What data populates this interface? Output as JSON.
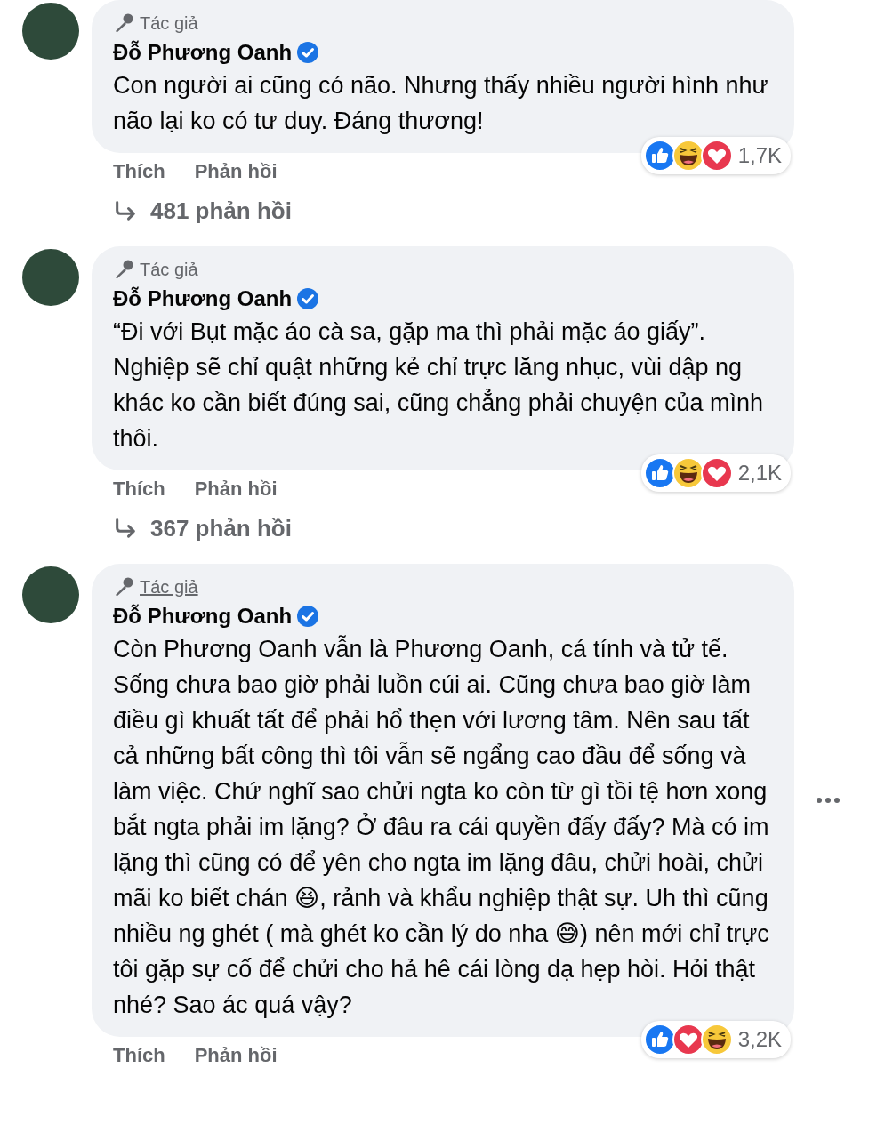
{
  "comments": [
    {
      "badge": "Tác giả",
      "badge_underlined": false,
      "author": "Đỗ Phương Oanh",
      "verified": true,
      "text": "Con người ai cũng có não. Nhưng thấy nhiều người hình như não lại ko có tư duy. Đáng thương!",
      "reactions": [
        {
          "kind": "like"
        },
        {
          "kind": "haha"
        },
        {
          "kind": "love"
        }
      ],
      "reaction_count": "1,7K",
      "actions": [
        "Thích",
        "Phản hồi"
      ],
      "replies": "481 phản hồi",
      "more_menu": false
    },
    {
      "badge": "Tác giả",
      "badge_underlined": false,
      "author": "Đỗ Phương Oanh",
      "verified": true,
      "text": "“Đi với Bụt mặc áo cà sa, gặp ma thì phải mặc áo giấy”. Nghiệp sẽ chỉ quật những kẻ chỉ trực lăng nhục, vùi dập ng khác ko cần biết đúng sai, cũng chẳng phải chuyện của mình thôi.",
      "reactions": [
        {
          "kind": "like"
        },
        {
          "kind": "haha"
        },
        {
          "kind": "love"
        }
      ],
      "reaction_count": "2,1K",
      "actions": [
        "Thích",
        "Phản hồi"
      ],
      "replies": "367 phản hồi",
      "more_menu": false
    },
    {
      "badge": "Tác giả",
      "badge_underlined": true,
      "author": "Đỗ Phương Oanh",
      "verified": true,
      "text": "Còn Phương Oanh vẫn là Phương Oanh, cá tính và tử tế. Sống chưa bao giờ phải luồn cúi ai. Cũng chưa bao giờ làm điều gì khuất tất để phải hổ thẹn với lương tâm. Nên sau tất cả những bất công thì tôi vẫn sẽ ngẩng cao đầu để sống và làm việc. Chứ nghĩ sao chửi ngta ko còn từ gì tồi tệ hơn xong bắt ngta phải im lặng? Ở đâu ra cái quyền đấy đấy? Mà có im lặng thì cũng có để yên cho ngta im lặng đâu, chửi hoài, chửi mãi ko biết chán 😆, rảnh và khẩu nghiệp thật sự. Uh thì cũng nhiều ng ghét ( mà ghét ko cần lý do nha 😅) nên mới chỉ trực tôi gặp sự cố để chửi cho hả hê cái lòng dạ hẹp hòi. Hỏi thật nhé? Sao ác quá vậy?",
      "reactions": [
        {
          "kind": "like"
        },
        {
          "kind": "love"
        },
        {
          "kind": "haha"
        }
      ],
      "reaction_count": "3,2K",
      "actions": [
        "Thích",
        "Phản hồi"
      ],
      "more_menu": true
    }
  ]
}
